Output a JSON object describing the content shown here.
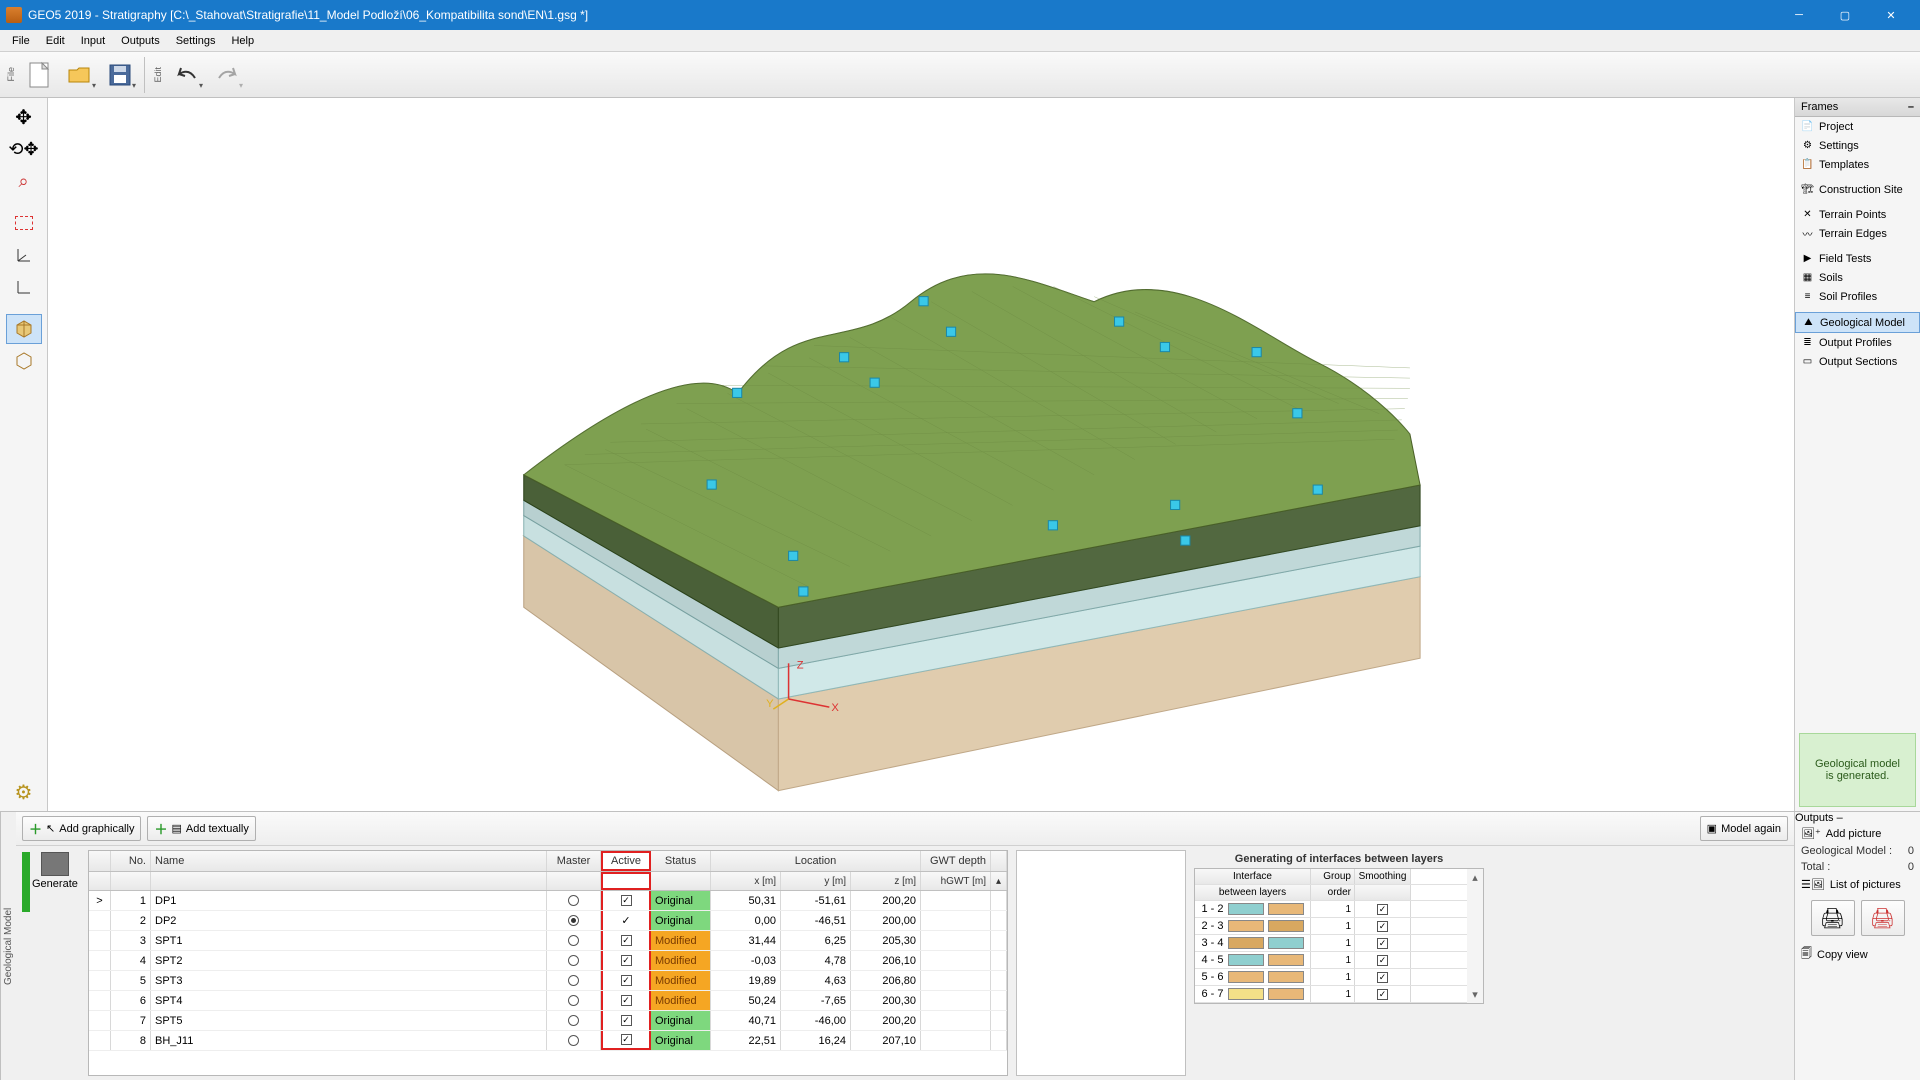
{
  "titlebar": {
    "title": "GEO5 2019 - Stratigraphy [C:\\_Stahovat\\Stratigrafie\\11_Model Podloží\\06_Kompatibilita sond\\EN\\1.gsg *]"
  },
  "menu": [
    "File",
    "Edit",
    "Input",
    "Outputs",
    "Settings",
    "Help"
  ],
  "toolbar": {
    "file_label": "File",
    "edit_label": "Edit"
  },
  "frames": {
    "title": "Frames",
    "groups": [
      [
        {
          "icon": "📄",
          "label": "Project",
          "name": "project"
        },
        {
          "icon": "⚙",
          "label": "Settings",
          "name": "settings"
        },
        {
          "icon": "📋",
          "label": "Templates",
          "name": "templates"
        }
      ],
      [
        {
          "icon": "🏗",
          "label": "Construction Site",
          "name": "construction-site"
        }
      ],
      [
        {
          "icon": "✕",
          "label": "Terrain Points",
          "name": "terrain-points"
        },
        {
          "icon": "〰",
          "label": "Terrain Edges",
          "name": "terrain-edges"
        }
      ],
      [
        {
          "icon": "▶",
          "label": "Field Tests",
          "name": "field-tests"
        },
        {
          "icon": "▦",
          "label": "Soils",
          "name": "soils"
        },
        {
          "icon": "≡",
          "label": "Soil Profiles",
          "name": "soil-profiles"
        }
      ],
      [
        {
          "icon": "⛰",
          "label": "Geological Model",
          "name": "geological-model",
          "selected": true
        },
        {
          "icon": "≣",
          "label": "Output Profiles",
          "name": "output-profiles"
        },
        {
          "icon": "▭",
          "label": "Output Sections",
          "name": "output-sections"
        }
      ]
    ],
    "status": "Geological model\nis generated."
  },
  "buttons": {
    "add_graph": "Add graphically",
    "add_text": "Add textually",
    "model_again": "Model again",
    "generate": "Generate"
  },
  "boreholes": {
    "headers": {
      "no": "No.",
      "name": "Name",
      "master": "Master",
      "active": "Active",
      "status": "Status",
      "location": "Location",
      "gwt": "GWT depth",
      "x": "x [m]",
      "y": "y [m]",
      "z": "z [m]",
      "hgwt": "hGWT [m]"
    },
    "rows": [
      {
        "no": 1,
        "name": "DP1",
        "master": "o",
        "active": "☑",
        "status": "Original",
        "x": "50,31",
        "y": "-51,61",
        "z": "200,20",
        "gwt": "",
        "caret": ">"
      },
      {
        "no": 2,
        "name": "DP2",
        "master": "●",
        "active": "✓",
        "status": "Original",
        "x": "0,00",
        "y": "-46,51",
        "z": "200,00",
        "gwt": ""
      },
      {
        "no": 3,
        "name": "SPT1",
        "master": "o",
        "active": "☑",
        "status": "Modified",
        "x": "31,44",
        "y": "6,25",
        "z": "205,30",
        "gwt": ""
      },
      {
        "no": 4,
        "name": "SPT2",
        "master": "o",
        "active": "☑",
        "status": "Modified",
        "x": "-0,03",
        "y": "4,78",
        "z": "206,10",
        "gwt": ""
      },
      {
        "no": 5,
        "name": "SPT3",
        "master": "o",
        "active": "☑",
        "status": "Modified",
        "x": "19,89",
        "y": "4,63",
        "z": "206,80",
        "gwt": ""
      },
      {
        "no": 6,
        "name": "SPT4",
        "master": "o",
        "active": "☑",
        "status": "Modified",
        "x": "50,24",
        "y": "-7,65",
        "z": "200,30",
        "gwt": ""
      },
      {
        "no": 7,
        "name": "SPT5",
        "master": "o",
        "active": "☑",
        "status": "Original",
        "x": "40,71",
        "y": "-46,00",
        "z": "200,20",
        "gwt": ""
      },
      {
        "no": 8,
        "name": "BH_J11",
        "master": "o",
        "active": "☑",
        "status": "Original",
        "x": "22,51",
        "y": "16,24",
        "z": "207,10",
        "gwt": ""
      }
    ]
  },
  "interfaces": {
    "title": "Generating of interfaces between layers",
    "headers": {
      "interface": "Interface",
      "between": "between layers",
      "group": "Group",
      "order": "order",
      "smooth": "Smoothing"
    },
    "rows": [
      {
        "label": "1 - 2",
        "c1": "#8fcfcf",
        "c2": "#e8b878",
        "grp": 1,
        "sm": true
      },
      {
        "label": "2 - 3",
        "c1": "#e8b878",
        "c2": "#d8a860",
        "grp": 1,
        "sm": true
      },
      {
        "label": "3 - 4",
        "c1": "#d8a860",
        "c2": "#8fcfcf",
        "grp": 1,
        "sm": true
      },
      {
        "label": "4 - 5",
        "c1": "#8fcfcf",
        "c2": "#e8b878",
        "grp": 1,
        "sm": true
      },
      {
        "label": "5 - 6",
        "c1": "#e8b878",
        "c2": "#e8b878",
        "grp": 1,
        "sm": true
      },
      {
        "label": "6 - 7",
        "c1": "#f4e088",
        "c2": "#e8b878",
        "grp": 1,
        "sm": true
      }
    ]
  },
  "outputs": {
    "title": "Outputs",
    "add_picture": "Add picture",
    "stats": [
      {
        "k": "Geological Model :",
        "v": "0"
      },
      {
        "k": "Total :",
        "v": "0"
      }
    ],
    "list_pictures": "List of pictures",
    "copy_view": "Copy view"
  },
  "side_label": "Geological Model"
}
